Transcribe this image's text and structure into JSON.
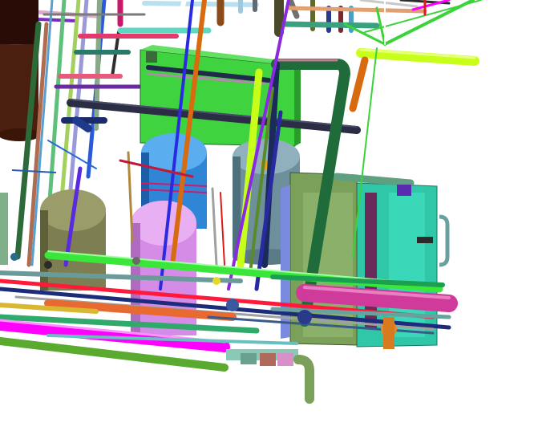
{
  "view": {
    "background": "#ffffff",
    "content": "3d-piping-model-render"
  },
  "palette": {
    "green_tank": "#3fd33f",
    "blue_vessel": "#2f86d6",
    "violet_vessel": "#d58ce6",
    "olive_vessel": "#7d7f52",
    "slate_vessel": "#6e8f9c",
    "teal_box": "#2fc7a7",
    "olive_box": "#7aa05a",
    "brown_vessel": "#4a1f10",
    "magenta_pipe": "#ff00ff",
    "lime_pipe": "#c8ff1a",
    "dark_green_pipe": "#1f6b3a",
    "orange_pipe": "#d86a10",
    "red_pipe": "#ff1a3c",
    "navy_pipe": "#1c2c7a"
  }
}
